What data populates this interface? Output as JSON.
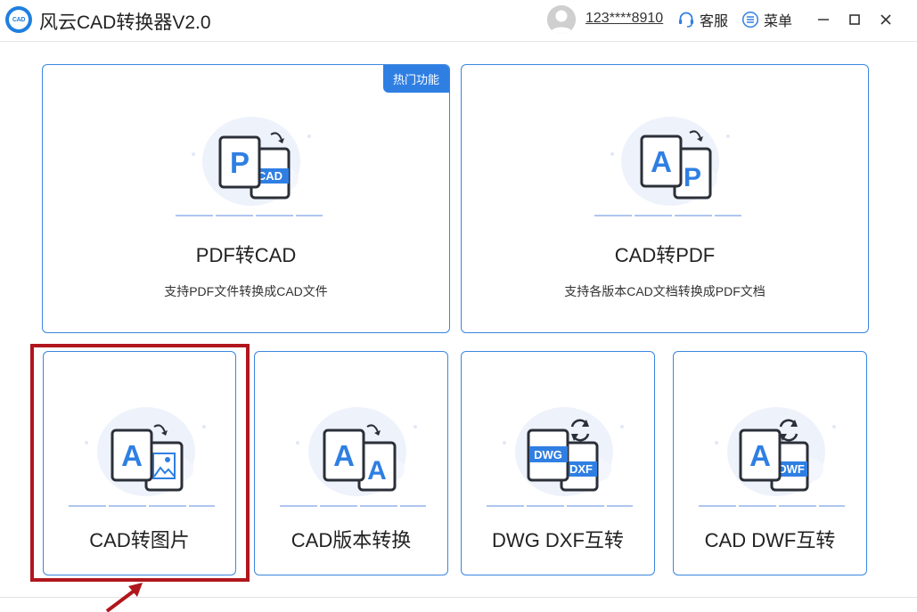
{
  "app": {
    "logo_text": "CAD",
    "title": "风云CAD转换器V2.0"
  },
  "header": {
    "user_name": "123****8910",
    "service_label": "客服",
    "menu_label": "菜单"
  },
  "cards": {
    "pdf_to_cad": {
      "badge": "热门功能",
      "title": "PDF转CAD",
      "description": "支持PDF文件转换成CAD文件",
      "front_letter": "P",
      "back_label": "CAD"
    },
    "cad_to_pdf": {
      "title": "CAD转PDF",
      "description": "支持各版本CAD文档转换成PDF文档",
      "front_letter": "A",
      "back_letter": "P"
    },
    "cad_to_image": {
      "title": "CAD转图片",
      "front_letter": "A"
    },
    "cad_version": {
      "title": "CAD版本转换",
      "front_letter": "A",
      "back_letter": "A"
    },
    "dwg_dxf": {
      "title": "DWG DXF互转",
      "front_label": "DWG",
      "back_label": "DXF"
    },
    "cad_dwf": {
      "title": "CAD DWF互转",
      "front_letter": "A",
      "back_label": "DWF"
    }
  },
  "colors": {
    "accent": "#2f7fe3",
    "card_border": "#3a86e0",
    "highlight": "#b0161c",
    "icon_blue": "#2f7fe3",
    "icon_stroke": "#2b2f38"
  }
}
